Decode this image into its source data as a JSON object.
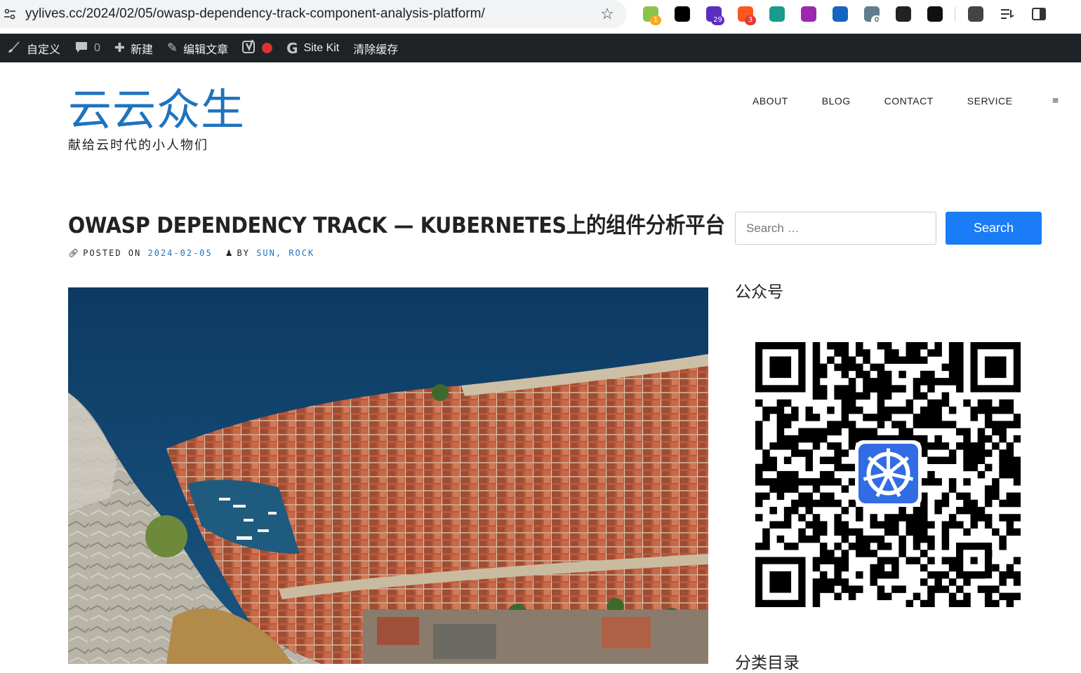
{
  "browser": {
    "url": "yylives.cc/2024/02/05/owasp-dependency-track-component-analysis-platform/",
    "extensions": [
      {
        "name": "extension-1",
        "badge": "1",
        "color": "#8bc34a",
        "badge_color": "#f9a825"
      },
      {
        "name": "notion-extension",
        "badge": "",
        "color": "#000000",
        "badge_color": ""
      },
      {
        "name": "extension-29",
        "badge": "29",
        "color": "#5b2dbf",
        "badge_color": "#5b2dbf"
      },
      {
        "name": "extension-3",
        "badge": "3",
        "color": "#ff5722",
        "badge_color": "#e53935"
      },
      {
        "name": "extension-teal",
        "badge": "",
        "color": "#1a9c8c",
        "badge_color": ""
      },
      {
        "name": "extension-purple",
        "badge": "",
        "color": "#9c27b0",
        "badge_color": ""
      },
      {
        "name": "extension-blue",
        "badge": "",
        "color": "#1565c0",
        "badge_color": ""
      },
      {
        "name": "extension-0",
        "badge": "0",
        "color": "#607d8b",
        "badge_color": "#ffffff"
      },
      {
        "name": "extension-dark",
        "badge": "",
        "color": "#222222",
        "badge_color": ""
      },
      {
        "name": "medium-extension",
        "badge": "",
        "color": "#111111",
        "badge_color": ""
      },
      {
        "name": "extensions-puzzle",
        "badge": "",
        "color": "#444444",
        "badge_color": ""
      }
    ]
  },
  "adminbar": {
    "customize": "自定义",
    "comments_count": "0",
    "new": "新建",
    "edit_post": "编辑文章",
    "sitekit": "Site Kit",
    "clear_cache": "清除缓存"
  },
  "site": {
    "title": "云云众生",
    "description": "献给云时代的小人物们"
  },
  "nav": {
    "items": [
      "ABOUT",
      "BLOG",
      "CONTACT",
      "SERVICE"
    ],
    "menu_icon": "≡"
  },
  "post": {
    "title": "OWASP DEPENDENCY TRACK — KUBERNETES上的组件分析平台",
    "posted_on_label": "POSTED ON",
    "date": "2024-02-05",
    "by_label": "BY",
    "author": "SUN, ROCK"
  },
  "sidebar": {
    "search_placeholder": "Search …",
    "search_button": "Search",
    "wechat_title": "公众号",
    "categories_title": "分类目录"
  },
  "colors": {
    "accent": "#1e73be",
    "search_button": "#1a7cf6",
    "adminbar": "#1d2327"
  }
}
